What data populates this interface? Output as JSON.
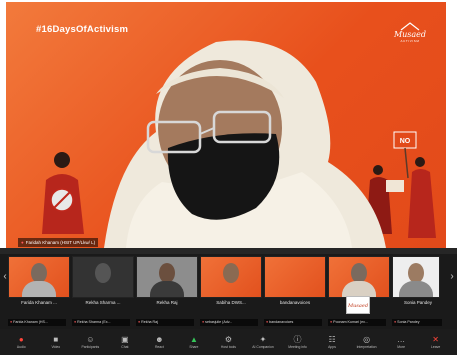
{
  "main": {
    "hashtag": "#16DaysOfActivism",
    "logo_word": "Musaed",
    "logo_sub": "ACTIVISM",
    "placard_text": "NO",
    "speaker_label": "Faridah Khanam (HSIT UP/Lkw/ L)"
  },
  "participants": [
    {
      "name": "Farida Khanam ...",
      "label": "Farida Khanam (HS..."
    },
    {
      "name": "Rekha Sharma ...",
      "label": "Rekha Sharma (Ex..."
    },
    {
      "name": "Rekha Raj",
      "label": "Rekha Raj"
    },
    {
      "name": "Sabiha DWS...",
      "label": "sebasjulie (Adv..."
    },
    {
      "name": "bandanavoices",
      "label": "bandanavoices"
    },
    {
      "name": "",
      "label": "Poonam Kumari (ex..."
    },
    {
      "name": "Sonia Pandey",
      "label": "Sonia Pandey"
    }
  ],
  "mini_logo": "Musaed",
  "toolbar": [
    {
      "icon": "mic-off-icon",
      "glyph": "●",
      "label": "Audio"
    },
    {
      "icon": "video-icon",
      "glyph": "■",
      "label": "Video"
    },
    {
      "icon": "participants-icon",
      "glyph": "☺",
      "label": "Participants"
    },
    {
      "icon": "chat-icon",
      "glyph": "▣",
      "label": "Chat"
    },
    {
      "icon": "react-icon",
      "glyph": "☻",
      "label": "React"
    },
    {
      "icon": "share-icon",
      "glyph": "▲",
      "label": "Share"
    },
    {
      "icon": "host-tools-icon",
      "glyph": "⚙",
      "label": "Host tools"
    },
    {
      "icon": "ai-companion-icon",
      "glyph": "✦",
      "label": "AI Companion"
    },
    {
      "icon": "meeting-info-icon",
      "glyph": "ⓘ",
      "label": "Meeting info"
    },
    {
      "icon": "apps-icon",
      "glyph": "☷",
      "label": "Apps"
    },
    {
      "icon": "interpretation-icon",
      "glyph": "◎",
      "label": "Interpretation"
    },
    {
      "icon": "more-icon",
      "glyph": "…",
      "label": "More"
    },
    {
      "icon": "leave-icon",
      "glyph": "✕",
      "label": "Leave"
    }
  ]
}
